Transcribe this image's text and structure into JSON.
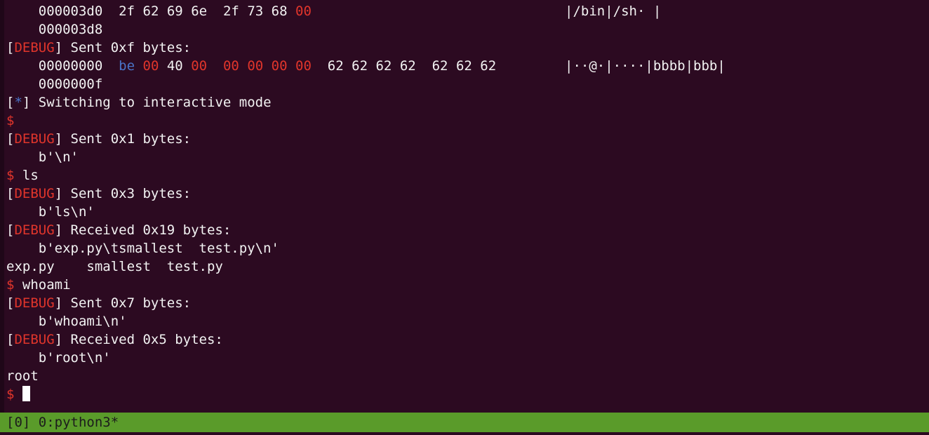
{
  "terminal": {
    "lines": [
      {
        "type": "hex",
        "offset": "000003d0",
        "bytes": [
          [
            "2f",
            "n"
          ],
          [
            "62",
            "n"
          ],
          [
            "69",
            "n"
          ],
          [
            "6e",
            "n"
          ],
          [
            "2f",
            "n"
          ],
          [
            "73",
            "n"
          ],
          [
            "68",
            "n"
          ],
          [
            "00",
            "r"
          ]
        ],
        "ascii": "|/bin|/sh· |"
      },
      {
        "type": "plain",
        "text": "000003d8",
        "indent": true
      },
      {
        "type": "debug",
        "tag": "DEBUG",
        "text": "] Sent 0xf bytes:"
      },
      {
        "type": "hex",
        "offset": "00000000",
        "bytes": [
          [
            "be",
            "b"
          ],
          [
            "00",
            "r"
          ],
          [
            "40",
            "n"
          ],
          [
            "00",
            "r"
          ],
          [
            "00",
            "r"
          ],
          [
            "00",
            "r"
          ],
          [
            "00",
            "r"
          ],
          [
            "00",
            "r"
          ],
          [
            "62",
            "n"
          ],
          [
            "62",
            "n"
          ],
          [
            "62",
            "n"
          ],
          [
            "62",
            "n"
          ],
          [
            "62",
            "n"
          ],
          [
            "62",
            "n"
          ],
          [
            "62",
            "n"
          ]
        ],
        "ascii": "|··@·|····|bbbb|bbb|"
      },
      {
        "type": "plain",
        "text": "0000000f",
        "indent": true
      },
      {
        "type": "info",
        "tag": "*",
        "text": "] Switching to interactive mode"
      },
      {
        "type": "prompt",
        "text": ""
      },
      {
        "type": "debug",
        "tag": "DEBUG",
        "text": "] Sent 0x1 bytes:"
      },
      {
        "type": "plain",
        "text": "b'\\n'",
        "indent": true
      },
      {
        "type": "prompt",
        "text": " ls"
      },
      {
        "type": "debug",
        "tag": "DEBUG",
        "text": "] Sent 0x3 bytes:"
      },
      {
        "type": "plain",
        "text": "b'ls\\n'",
        "indent": true
      },
      {
        "type": "debug",
        "tag": "DEBUG",
        "text": "] Received 0x19 bytes:"
      },
      {
        "type": "plain",
        "text": "b'exp.py\\tsmallest  test.py\\n'",
        "indent": true
      },
      {
        "type": "plain",
        "text": "exp.py    smallest  test.py",
        "indent": false
      },
      {
        "type": "prompt",
        "text": " whoami"
      },
      {
        "type": "debug",
        "tag": "DEBUG",
        "text": "] Sent 0x7 bytes:"
      },
      {
        "type": "plain",
        "text": "b'whoami\\n'",
        "indent": true
      },
      {
        "type": "debug",
        "tag": "DEBUG",
        "text": "] Received 0x5 bytes:"
      },
      {
        "type": "plain",
        "text": "b'root\\n'",
        "indent": true
      },
      {
        "type": "plain",
        "text": "root",
        "indent": false
      },
      {
        "type": "prompt_cursor",
        "text": " "
      }
    ]
  },
  "tmux": {
    "session": "[0]",
    "window": " 0:python3*"
  },
  "colors": {
    "background": "#2c0a21",
    "status_bar": "#5a9b2a",
    "debug_red": "#e0352b",
    "info_blue": "#4a74c8"
  }
}
